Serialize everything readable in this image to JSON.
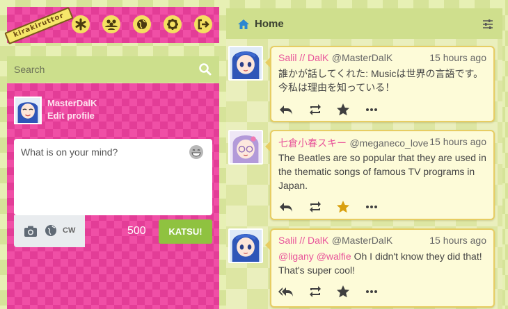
{
  "app": {
    "logo_text": "kirakiruttor"
  },
  "nav": {
    "icons": [
      "asterisk-icon",
      "users-icon",
      "globe-icon",
      "gear-icon",
      "logout-icon"
    ]
  },
  "search": {
    "placeholder": "Search"
  },
  "profile": {
    "username": "MasterDalK",
    "edit_label": "Edit profile"
  },
  "compose": {
    "placeholder": "What is on your mind?",
    "cw_label": "CW",
    "char_count": "500",
    "submit_label": "KATSU!"
  },
  "column": {
    "title": "Home"
  },
  "statuses": [
    {
      "display_name": "Salil // DalK",
      "acct": "@MasterDalK",
      "time": "15 hours ago",
      "text": "誰かが話してくれた: Musicは世界の言語です。今私は理由を知っている！",
      "favourited": false
    },
    {
      "display_name": "七倉小春スキー",
      "acct": "@meganeco_love",
      "time": "15 hours ago",
      "text": "The Beatles are so popular that they are used in the thematic songs of famous TV programs in Japan.",
      "favourited": true
    },
    {
      "display_name": "Salil // DalK",
      "acct": "@MasterDalK",
      "time": "15 hours ago",
      "mention_1": "@ligany",
      "mention_2": "@walfie",
      "text": "Oh I didn't know they did that! That's super cool!",
      "favourited": false
    }
  ],
  "colors": {
    "pink": "#f04fa6",
    "lime": "#cfdf8d",
    "green_button": "#8fc240",
    "star_active": "#d9a00f",
    "name_pink": "#e8539a"
  }
}
